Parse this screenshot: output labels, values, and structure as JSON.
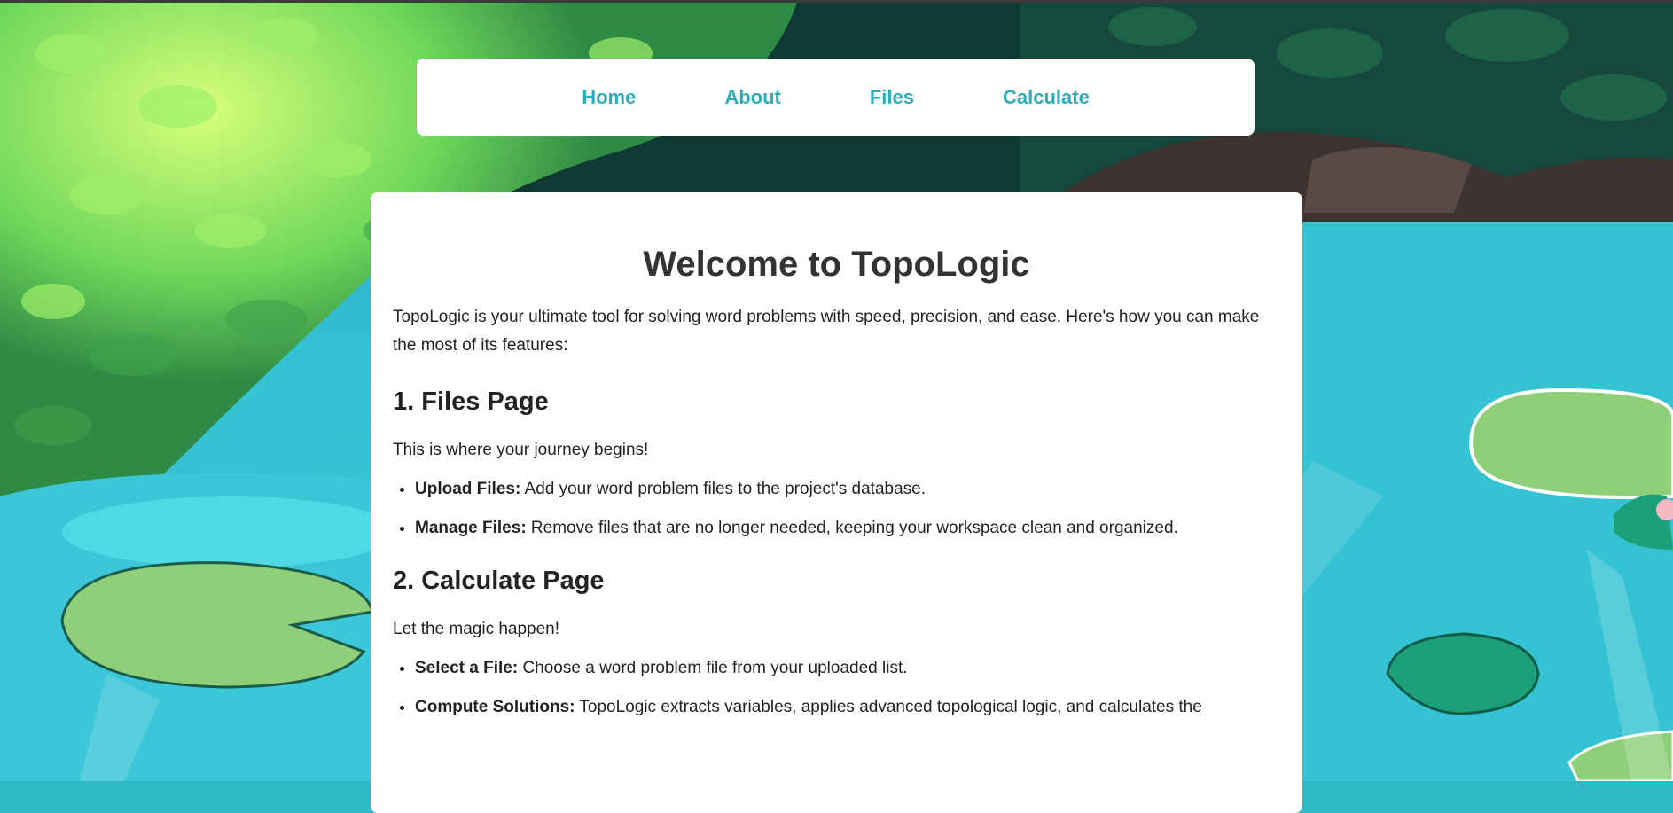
{
  "nav": {
    "items": [
      {
        "label": "Home"
      },
      {
        "label": "About"
      },
      {
        "label": "Files"
      },
      {
        "label": "Calculate"
      }
    ]
  },
  "main": {
    "title": "Welcome to TopoLogic",
    "intro": "TopoLogic is your ultimate tool for solving word problems with speed, precision, and ease. Here's how you can make the most of its features:",
    "sections": [
      {
        "heading": "1. Files Page",
        "lead": "This is where your journey begins!",
        "items": [
          {
            "bold": "Upload Files:",
            "text": " Add your word problem files to the project's database."
          },
          {
            "bold": "Manage Files:",
            "text": " Remove files that are no longer needed, keeping your workspace clean and organized."
          }
        ]
      },
      {
        "heading": "2. Calculate Page",
        "lead": "Let the magic happen!",
        "items": [
          {
            "bold": "Select a File:",
            "text": " Choose a word problem file from your uploaded list."
          },
          {
            "bold": "Compute Solutions:",
            "text": " TopoLogic extracts variables, applies advanced topological logic, and calculates the"
          }
        ]
      }
    ]
  },
  "theme": {
    "accent": "#2aaeb7",
    "water": "#2fb8c6",
    "foliage": "#5fcf55"
  }
}
